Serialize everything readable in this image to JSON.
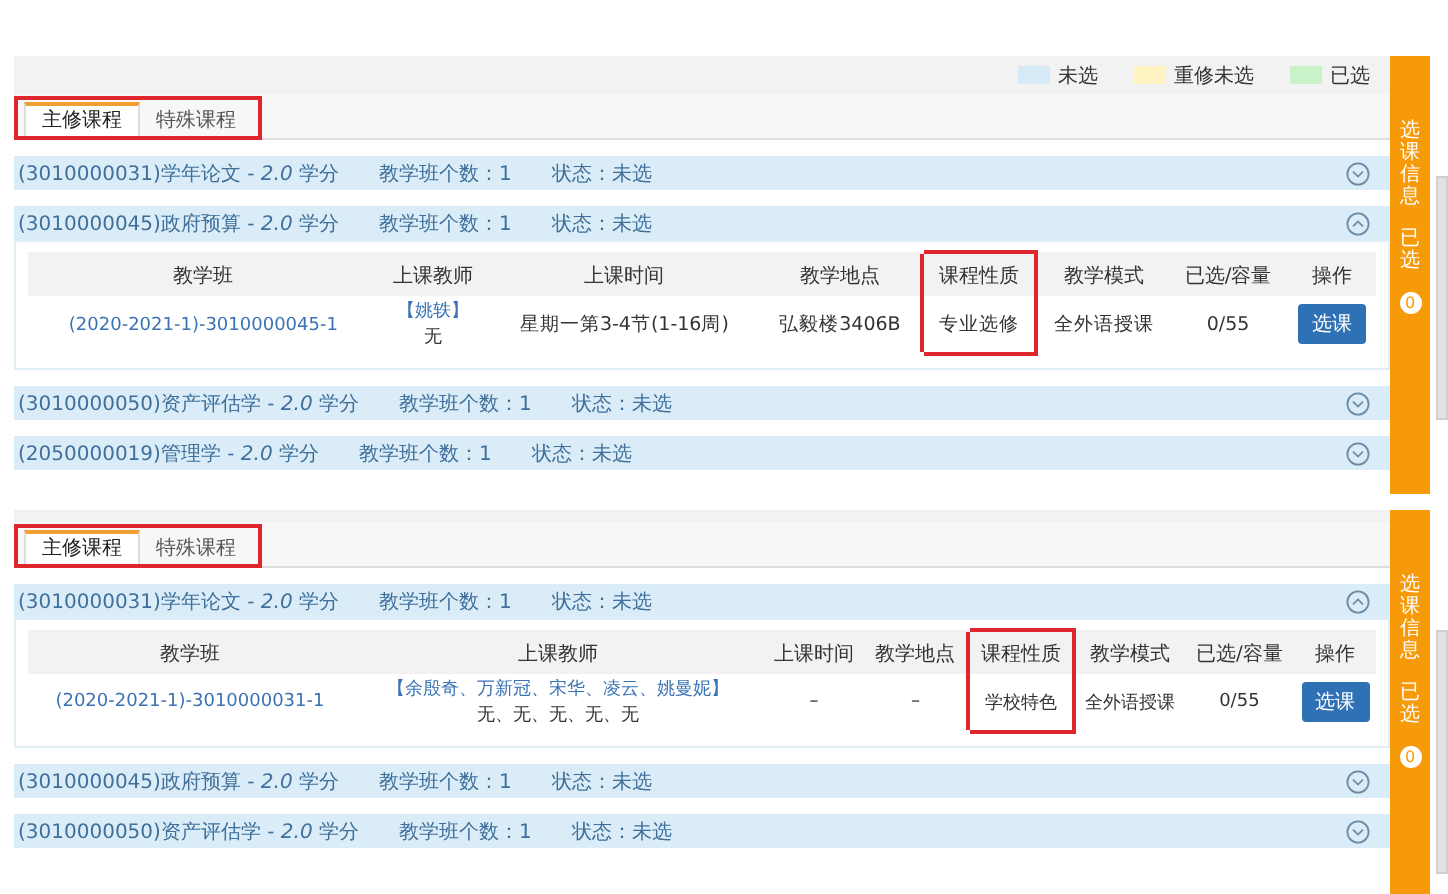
{
  "panels": [
    {
      "legend": [
        {
          "label": "未选",
          "color": "#d6eaf8"
        },
        {
          "label": "重修未选",
          "color": "#fff3c4"
        },
        {
          "label": "已选",
          "color": "#c9f2c9"
        }
      ],
      "tabs": [
        {
          "label": "主修课程",
          "selected": true
        },
        {
          "label": "特殊课程",
          "selected": false
        }
      ],
      "courses": [
        {
          "title": "(3010000031)学年论文 - *2.0* 学分",
          "count": "教学班个数：1",
          "status": "状态：未选",
          "expanded": false
        },
        {
          "title": "(3010000045)政府预算 - *2.0* 学分",
          "count": "教学班个数：1",
          "status": "状态：未选",
          "expanded": true,
          "columns": [
            {
              "label": "教学班",
              "highlighted": false
            },
            {
              "label": "上课教师",
              "highlighted": false
            },
            {
              "label": "上课时间",
              "highlighted": false
            },
            {
              "label": "教学地点",
              "highlighted": false
            },
            {
              "label": "课程性质",
              "highlighted": true
            },
            {
              "label": "教学模式",
              "highlighted": false
            },
            {
              "label": "已选/容量",
              "highlighted": false
            },
            {
              "label": "操作",
              "highlighted": false
            }
          ],
          "rows": [
            {
              "class": "(2020-2021-1)-3010000045-1",
              "teachers": "【姚轶】",
              "teacher_titles": "无",
              "time": "星期一第3-4节(1-16周)",
              "place": "弘毅楼3406B",
              "nature": "专业选修",
              "mode": "全外语授课",
              "enrolled": "0/55",
              "action": "选课"
            }
          ]
        },
        {
          "title": "(3010000050)资产评估学 - *2.0* 学分",
          "count": "教学班个数：1",
          "status": "状态：未选",
          "expanded": false
        },
        {
          "title": "(2050000019)管理学 - *2.0* 学分",
          "count": "教学班个数：1",
          "status": "状态：未选",
          "expanded": false
        }
      ],
      "sidebar": {
        "title": "选课信息",
        "selected_label": "已选",
        "count": "0"
      }
    },
    {
      "tabs": [
        {
          "label": "主修课程",
          "selected": true
        },
        {
          "label": "特殊课程",
          "selected": false
        }
      ],
      "courses": [
        {
          "title": "(3010000031)学年论文 - *2.0* 学分",
          "count": "教学班个数：1",
          "status": "状态：未选",
          "expanded": true,
          "columns": [
            {
              "label": "教学班",
              "highlighted": false
            },
            {
              "label": "上课教师",
              "highlighted": false
            },
            {
              "label": "上课时间",
              "highlighted": false
            },
            {
              "label": "教学地点",
              "highlighted": false
            },
            {
              "label": "课程性质",
              "highlighted": true
            },
            {
              "label": "教学模式",
              "highlighted": false
            },
            {
              "label": "已选/容量",
              "highlighted": false
            },
            {
              "label": "操作",
              "highlighted": false
            }
          ],
          "rows": [
            {
              "class": "(2020-2021-1)-3010000031-1",
              "teachers": "【余殷奇、万新冠、宋华、凌云、姚曼妮】",
              "teacher_titles": "无、无、无、无、无",
              "time": "–",
              "place": "–",
              "nature": "学校特色",
              "mode": "全外语授课",
              "enrolled": "0/55",
              "action": "选课"
            }
          ]
        },
        {
          "title": "(3010000045)政府预算 - *2.0* 学分",
          "count": "教学班个数：1",
          "status": "状态：未选",
          "expanded": false
        },
        {
          "title": "(3010000050)资产评估学 - *2.0* 学分",
          "count": "教学班个数：1",
          "status": "状态：未选",
          "expanded": false
        }
      ],
      "sidebar": {
        "title": "选课信息",
        "selected_label": "已选",
        "count": "0"
      }
    }
  ]
}
